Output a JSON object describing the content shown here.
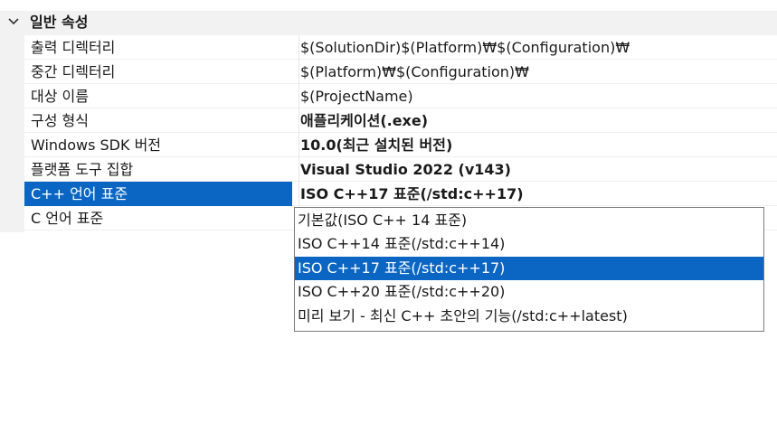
{
  "section": {
    "title": "일반 속성"
  },
  "properties": [
    {
      "name": "출력 디렉터리",
      "value": "$(SolutionDir)$(Platform)₩$(Configuration)₩",
      "bold": false
    },
    {
      "name": "중간 디렉터리",
      "value": "$(Platform)₩$(Configuration)₩",
      "bold": false
    },
    {
      "name": "대상 이름",
      "value": "$(ProjectName)",
      "bold": false
    },
    {
      "name": "구성 형식",
      "value": "애플리케이션(.exe)",
      "bold": true
    },
    {
      "name": "Windows SDK 버전",
      "value": "10.0(최근 설치된 버전)",
      "bold": true
    },
    {
      "name": "플랫폼 도구 집합",
      "value": "Visual Studio 2022 (v143)",
      "bold": true
    },
    {
      "name": "C++ 언어 표준",
      "value": "ISO C++17 표준(/std:c++17)",
      "bold": true
    },
    {
      "name": "C 언어 표준",
      "value": "",
      "bold": false
    }
  ],
  "dropdown": {
    "options": [
      "기본값(ISO C++ 14 표준)",
      "ISO C++14 표준(/std:c++14)",
      "ISO C++17 표준(/std:c++17)",
      "ISO C++20 표준(/std:c++20)",
      "미리 보기 - 최신 C++ 초안의 기능(/std:c++latest)"
    ],
    "selected_index": 2
  },
  "colors": {
    "selection": "#0a66c2",
    "header_bg": "#f2f2f2"
  }
}
